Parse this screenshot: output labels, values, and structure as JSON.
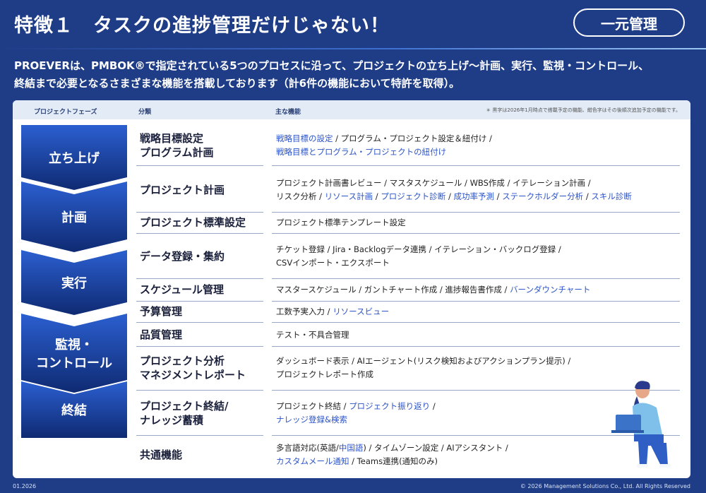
{
  "header": {
    "title": "特徴１　タスクの進捗管理だけじゃない！",
    "badge": "一元管理"
  },
  "intro": {
    "line1": "PROEVERは、PMBOK®で指定されている5つのプロセスに沿って、プロジェクトの立ち上げ〜計画、実行、監視・コントロール、",
    "line2": "終結まで必要となるさまざまな機能を搭載しております（計6件の機能において特許を取得）。"
  },
  "table_header": {
    "phase": "プロジェクトフェーズ",
    "category": "分類",
    "features": "主な機能",
    "note": "＊ 黒字は2026年1月時点で搭載予定の機能、紺色字はその後順次追加予定の機能です。"
  },
  "phases": [
    {
      "label": "立ち上げ"
    },
    {
      "label": "計画"
    },
    {
      "label": "実行"
    },
    {
      "label": "監視・",
      "label2": "コントロール"
    },
    {
      "label": "終結"
    }
  ],
  "colors": {
    "background": "#1f3d87",
    "accent_feature": "#2c54c8",
    "phase_top": "#2b5fd0",
    "phase_bottom": "#0f2a72"
  },
  "rows": [
    {
      "cat": "戦略目標設定",
      "cat2": "プログラム計画",
      "f": [
        {
          "t": "戦略目標の設定",
          "b": true
        },
        {
          "t": " / プログラム・プロジェクト設定＆紐付け /",
          "b": false
        },
        {
          "br": true
        },
        {
          "t": "戦略目標とプログラム・プロジェクトの紐付け",
          "b": true
        }
      ]
    },
    {
      "cat": "プロジェクト計画",
      "f": [
        {
          "t": "プロジェクト計画書レビュー / マスタスケジュール / WBS作成 / イテレーション計画 /",
          "b": false
        },
        {
          "br": true
        },
        {
          "t": "リスク分析 / ",
          "b": false
        },
        {
          "t": "リソース計画",
          "b": true
        },
        {
          "t": " / ",
          "b": false
        },
        {
          "t": "プロジェクト診断",
          "b": true
        },
        {
          "t": " / ",
          "b": false
        },
        {
          "t": "成功率予測",
          "b": true
        },
        {
          "t": " / ",
          "b": false
        },
        {
          "t": "ステークホルダー分析",
          "b": true
        },
        {
          "t": " / ",
          "b": false
        },
        {
          "t": "スキル診断",
          "b": true
        }
      ]
    },
    {
      "cat": "プロジェクト標準設定",
      "f": [
        {
          "t": "プロジェクト標準テンプレート設定",
          "b": false
        }
      ]
    },
    {
      "cat": "データ登録・集約",
      "f": [
        {
          "t": "チケット登録 / Jira・Backlogデータ連携 / イテレーション・バックログ登録 /",
          "b": false
        },
        {
          "br": true
        },
        {
          "t": "CSVインポート・エクスポート",
          "b": false
        }
      ]
    },
    {
      "cat": "スケジュール管理",
      "f": [
        {
          "t": "マスタースケジュール / ガントチャート作成 / 進捗報告書作成 / ",
          "b": false
        },
        {
          "t": "バーンダウンチャート",
          "b": true
        }
      ]
    },
    {
      "cat": "予算管理",
      "f": [
        {
          "t": "工数予実入力 / ",
          "b": false
        },
        {
          "t": "リソースビュー",
          "b": true
        }
      ]
    },
    {
      "cat": "品質管理",
      "f": [
        {
          "t": "テスト・不具合管理",
          "b": false
        }
      ]
    },
    {
      "cat": "プロジェクト分析",
      "cat2": "マネジメントレポート",
      "f": [
        {
          "t": "ダッシュボード表示 / AIエージェント(リスク検知およびアクションプラン提示) /",
          "b": false
        },
        {
          "br": true
        },
        {
          "t": "プロジェクトレポート作成",
          "b": false
        }
      ]
    },
    {
      "cat": "プロジェクト終結/",
      "cat2": "ナレッジ蓄積",
      "f": [
        {
          "t": "プロジェクト終結 / ",
          "b": false
        },
        {
          "t": "プロジェクト振り返り",
          "b": true
        },
        {
          "t": " /",
          "b": false
        },
        {
          "br": true
        },
        {
          "t": "ナレッジ登録&検索",
          "b": true
        }
      ]
    },
    {
      "cat": "共通機能",
      "f": [
        {
          "t": "多言語対応(英語/",
          "b": false
        },
        {
          "t": "中国語",
          "b": true
        },
        {
          "t": ") / タイムゾーン設定 / AIアシスタント /",
          "b": false
        },
        {
          "br": true
        },
        {
          "t": "カスタムメール通知",
          "b": true
        },
        {
          "t": " / Teams連携(通知のみ)",
          "b": false
        }
      ]
    }
  ],
  "footer": {
    "left": "01.2026",
    "right": "© 2026 Management Solutions Co., Ltd. All Rights Reserved"
  }
}
